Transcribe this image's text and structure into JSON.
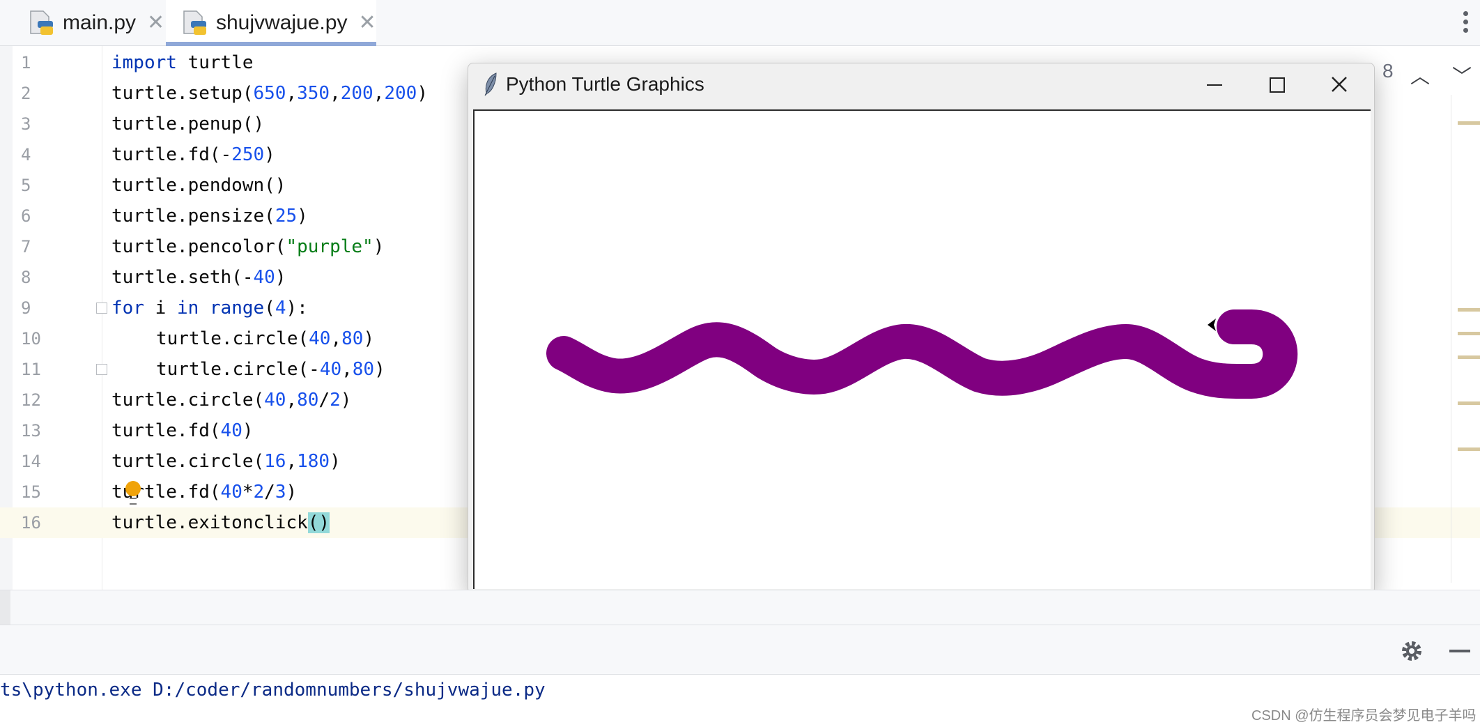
{
  "tabs": [
    {
      "label": "main.py",
      "close": "✕"
    },
    {
      "label": "shujvwajue.py",
      "close": "✕",
      "active": true
    }
  ],
  "editor": {
    "warning_count": "8",
    "lines": [
      {
        "n": "1",
        "indent": 0,
        "html": "<span class='kw'>import</span> turtle"
      },
      {
        "n": "2",
        "indent": 0,
        "html": "turtle.setup(<span class='num'>650</span>,<span class='num'>350</span>,<span class='num'>200</span>,<span class='num'>200</span>)"
      },
      {
        "n": "3",
        "indent": 0,
        "html": "turtle.penup()"
      },
      {
        "n": "4",
        "indent": 0,
        "html": "turtle.fd(-<span class='num'>250</span>)"
      },
      {
        "n": "5",
        "indent": 0,
        "html": "turtle.pendown()"
      },
      {
        "n": "6",
        "indent": 0,
        "html": "turtle.pensize(<span class='num'>25</span>)"
      },
      {
        "n": "7",
        "indent": 0,
        "html": "turtle.pencolor(<span class='str'>\"purple\"</span>)"
      },
      {
        "n": "8",
        "indent": 0,
        "html": "turtle.seth(-<span class='num'>40</span>)"
      },
      {
        "n": "9",
        "indent": 0,
        "html": "<span class='kw'>for</span> i <span class='kw'>in</span> <span class='kw'>range</span>(<span class='num'>4</span>):"
      },
      {
        "n": "10",
        "indent": 1,
        "html": "turtle.circle(<span class='num'>40</span>,<span class='num'>80</span>)"
      },
      {
        "n": "11",
        "indent": 1,
        "html": "turtle.circle(-<span class='num'>40</span>,<span class='num'>80</span>)"
      },
      {
        "n": "12",
        "indent": 0,
        "html": "turtle.circle(<span class='num'>40</span>,<span class='num'>80</span>/<span class='num'>2</span>)"
      },
      {
        "n": "13",
        "indent": 0,
        "html": "turtle.fd(<span class='num'>40</span>)"
      },
      {
        "n": "14",
        "indent": 0,
        "html": "turtle.circle(<span class='num'>16</span>,<span class='num'>180</span>)"
      },
      {
        "n": "15",
        "indent": 0,
        "html": "turtle.fd(<span class='num'>40</span>*<span class='num'>2</span>/<span class='num'>3</span>)"
      },
      {
        "n": "16",
        "indent": 0,
        "html": "turtle.exitonclick<span class='paren-hl'>()</span>",
        "current": true
      }
    ]
  },
  "turtle_window": {
    "title": "Python Turtle Graphics",
    "pen_color": "#800080"
  },
  "console": {
    "text": "ts\\python.exe D:/coder/randomnumbers/shujvwajue.py"
  },
  "watermark": "CSDN @仿生程序员会梦见电子羊吗"
}
